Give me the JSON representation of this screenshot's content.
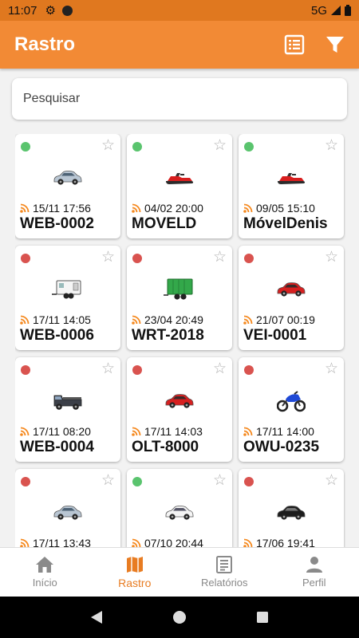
{
  "status_bar": {
    "time": "11:07",
    "network": "5G"
  },
  "app_bar": {
    "title": "Rastro"
  },
  "search": {
    "placeholder": "Pesquisar"
  },
  "colors": {
    "accent": "#f28a35",
    "online": "#5ac46e",
    "offline": "#d9534f"
  },
  "vehicles": [
    {
      "status": "online",
      "icon": "car-silver-icon",
      "datetime": "15/11 17:56",
      "plate": "WEB-0002"
    },
    {
      "status": "online",
      "icon": "jetski-red-icon",
      "datetime": "04/02 20:00",
      "plate": "MOVELD"
    },
    {
      "status": "online",
      "icon": "jetski-red-icon",
      "datetime": "09/05 15:10",
      "plate": "MóvelDenis"
    },
    {
      "status": "offline",
      "icon": "trailer-white-icon",
      "datetime": "17/11 14:05",
      "plate": "WEB-0006"
    },
    {
      "status": "offline",
      "icon": "trailer-green-icon",
      "datetime": "23/04 20:49",
      "plate": "WRT-2018"
    },
    {
      "status": "offline",
      "icon": "car-red-icon",
      "datetime": "21/07 00:19",
      "plate": "VEI-0001"
    },
    {
      "status": "offline",
      "icon": "truck-dark-icon",
      "datetime": "17/11 08:20",
      "plate": "WEB-0004"
    },
    {
      "status": "offline",
      "icon": "car-red-icon",
      "datetime": "17/11 14:03",
      "plate": "OLT-8000"
    },
    {
      "status": "offline",
      "icon": "motorcycle-blue-icon",
      "datetime": "17/11 14:00",
      "plate": "OWU-0235"
    },
    {
      "status": "offline",
      "icon": "car-silver-icon",
      "datetime": "17/11 13:43",
      "plate": ""
    },
    {
      "status": "online",
      "icon": "car-white-icon",
      "datetime": "07/10 20:44",
      "plate": ""
    },
    {
      "status": "offline",
      "icon": "car-black-icon",
      "datetime": "17/06 19:41",
      "plate": ""
    }
  ],
  "bottom_nav": {
    "items": [
      {
        "label": "Início",
        "icon": "home-icon"
      },
      {
        "label": "Rastro",
        "icon": "map-icon",
        "active": true
      },
      {
        "label": "Relatórios",
        "icon": "report-icon"
      },
      {
        "label": "Perfil",
        "icon": "person-icon"
      }
    ]
  }
}
